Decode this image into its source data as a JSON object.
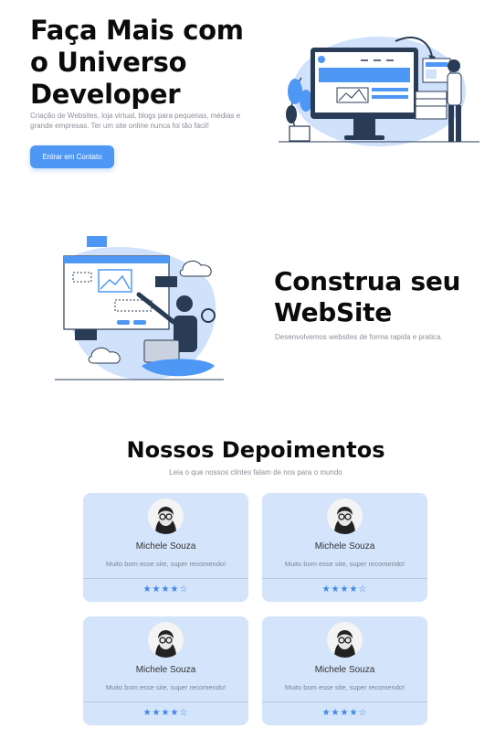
{
  "hero": {
    "title": "Faça Mais com o Universo Developer",
    "description": "Criação de Websites, loja virtual, blogs para pequenas, médias e grande empresas. Ter um site online nunca foi tão fácil!",
    "cta_label": "Entrar em Contato"
  },
  "build": {
    "title": "Construa seu WebSite",
    "description": "Desenvolvemos websites de forma rapida e pratica."
  },
  "testimonials": {
    "title": "Nossos Depoimentos",
    "subtitle": "Leia o que nossos clintes falam de nos para o mundo",
    "cards": [
      {
        "name": "Michele Souza",
        "text": "Muito bom esse site, super recomendo!",
        "rating": 4,
        "max_rating": 5
      },
      {
        "name": "Michele Souza",
        "text": "Muito bom esse site, super recomendo!",
        "rating": 4,
        "max_rating": 5
      },
      {
        "name": "Michele Souza",
        "text": "Muito bom esse site, super recomendo!",
        "rating": 4,
        "max_rating": 5
      },
      {
        "name": "Michele Souza",
        "text": "Muito bom esse site, super recomendo!",
        "rating": 4,
        "max_rating": 5
      }
    ]
  },
  "colors": {
    "accent": "#4f97f5",
    "card_bg": "#d3e4fb",
    "star": "#3f86e8"
  },
  "icons": {
    "hero_illustration": "developer-monitor-illustration",
    "build_illustration": "laptop-developer-illustration",
    "avatar": "user-avatar",
    "star_filled": "star-filled-icon",
    "star_empty": "star-outline-icon"
  }
}
